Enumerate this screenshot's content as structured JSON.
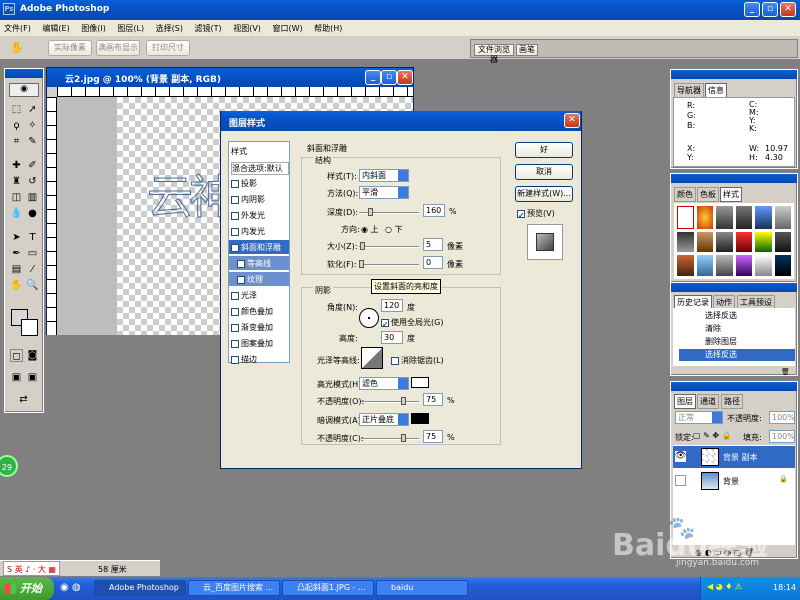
{
  "app": {
    "title": "Adobe Photoshop"
  },
  "menu": [
    "文件(F)",
    "编辑(E)",
    "图像(I)",
    "图层(L)",
    "选择(S)",
    "滤镜(T)",
    "视图(V)",
    "窗口(W)",
    "帮助(H)"
  ],
  "options": {
    "b1": "实际像素",
    "b2": "满画布显示",
    "b3": "打印尺寸"
  },
  "palette_well": {
    "tab1": "文件浏览器",
    "tab2": "画笔"
  },
  "document": {
    "title": "云2.jpg @ 100% (背景 副本, RGB)",
    "glyphs": "云神"
  },
  "dialog": {
    "title": "图层样式",
    "styles": [
      "样式",
      "混合选项:默认",
      "投影",
      "内阴影",
      "外发光",
      "内发光",
      "斜面和浮雕",
      "等高线",
      "纹理",
      "光泽",
      "颜色叠加",
      "渐变叠加",
      "图案叠加",
      "描边"
    ],
    "section_bevel": "斜面和浮雕",
    "structure": "结构",
    "style_label": "样式(T):",
    "style_value": "内斜面",
    "technique_label": "方法(Q):",
    "technique_value": "平滑",
    "depth_label": "深度(D):",
    "depth_value": "160",
    "depth_unit": "%",
    "direction_label": "方向:",
    "up": "上",
    "down": "下",
    "size_label": "大小(Z):",
    "size_value": "5",
    "size_unit": "像素",
    "soften_label": "软化(F):",
    "soften_value": "0",
    "soften_unit": "像素",
    "shading": "阴影",
    "tooltip": "设置斜面的亮和度",
    "angle_label": "角度(N):",
    "angle_value": "120",
    "angle_unit": "度",
    "global_light": "使用全局光(G)",
    "altitude_label": "高度:",
    "altitude_value": "30",
    "altitude_unit": "度",
    "gloss_label": "光泽等高线:",
    "antialias": "消除锯齿(L)",
    "hl_mode_label": "高光模式(H):",
    "hl_mode_value": "滤色",
    "hl_opacity_label": "不透明度(O):",
    "hl_opacity_value": "75",
    "pct": "%",
    "sh_mode_label": "暗调模式(A):",
    "sh_mode_value": "正片叠底",
    "sh_opacity_label": "不透明度(C):",
    "sh_opacity_value": "75",
    "ok": "好",
    "cancel": "取消",
    "new_style": "新建样式(W)...",
    "preview": "预览(V)",
    "depth_level": 0.16,
    "size_level": 0.02,
    "soften_level": 0.0,
    "hl_level": 0.75,
    "sh_level": 0.75
  },
  "info_panel": {
    "tab1": "导航器",
    "tab2": "信息",
    "rgb": "R:\nG:\nB:",
    "cmyk": "C:\nM:\nY:\nK:",
    "xy": "X:\nY:",
    "wh": "W:\nH:",
    "w": "10.97",
    "h": "4.30"
  },
  "styles_panel": {
    "tab1": "颜色",
    "tab2": "色板",
    "tab3": "样式"
  },
  "history_panel": {
    "tab1": "历史记录",
    "tab2": "动作",
    "tab3": "工具预设",
    "items": [
      "选择反选",
      "清除",
      "删除图层",
      "选择反选"
    ]
  },
  "layers_panel": {
    "tab1": "图层",
    "tab2": "通道",
    "tab3": "路径",
    "mode": "正常",
    "opacity_label": "不透明度:",
    "opacity": "100%",
    "lock_label": "锁定:",
    "fill_label": "填充:",
    "fill": "100%",
    "layers": [
      "背景 副本",
      "背景"
    ]
  },
  "status": {
    "zoom": "58 厘米",
    "ime": "英",
    "badge": "29"
  },
  "taskbar": {
    "start": "开始",
    "items": [
      "Adobe Photoshop",
      "云_百度图片搜索 ...",
      "凸起斜面1.JPG - ...",
      "baidu"
    ],
    "time": "18:14"
  },
  "watermark": {
    "text": "Baidu经验",
    "url": "jingyan.baidu.com"
  },
  "colors": {
    "xp_blue": "#0a5fd8",
    "taskbar": "#245edb",
    "start_green": "#3c9b2c",
    "highlight": "#316ac5"
  }
}
